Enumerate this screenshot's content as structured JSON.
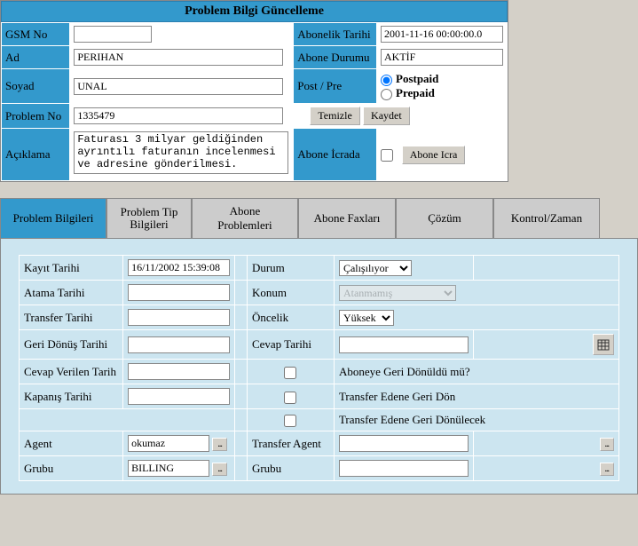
{
  "header": {
    "title": "Problem Bilgi Güncelleme"
  },
  "top": {
    "gsm_no": {
      "label": "GSM No",
      "value": ""
    },
    "abonelik_tarihi": {
      "label": "Abonelik Tarihi",
      "value": "2001-11-16 00:00:00.0"
    },
    "ad": {
      "label": "Ad",
      "value": "PERIHAN"
    },
    "abone_durumu": {
      "label": "Abone Durumu",
      "value": "AKTİF"
    },
    "soyad": {
      "label": "Soyad",
      "value": "UNAL"
    },
    "post_pre": {
      "label": "Post / Pre",
      "postpaid": "Postpaid",
      "prepaid": "Prepaid"
    },
    "problem_no": {
      "label": "Problem No",
      "value": "1335479"
    },
    "temizle": "Temizle",
    "kaydet": "Kaydet",
    "aciklama": {
      "label": "Açıklama",
      "value": "Faturası 3 milyar geldiğinden ayrıntılı faturanın incelenmesi ve adresine gönderilmesi."
    },
    "abone_icrada": {
      "label": "Abone İcrada",
      "button": "Abone Icra"
    }
  },
  "tabs": {
    "t1": "Problem Bilgileri",
    "t2": "Problem Tip Bilgileri",
    "t3": "Abone Problemleri",
    "t4": "Abone Faxları",
    "t5": "Çözüm",
    "t6": "Kontrol/Zaman"
  },
  "detail": {
    "kayit_tarihi": {
      "label": "Kayıt Tarihi",
      "value": "16/11/2002 15:39:08"
    },
    "durum": {
      "label": "Durum",
      "value": "Çalışılıyor"
    },
    "atama_tarihi": {
      "label": "Atama Tarihi",
      "value": ""
    },
    "konum": {
      "label": "Konum",
      "value": "Atanmamış"
    },
    "transfer_tarihi": {
      "label": "Transfer Tarihi",
      "value": ""
    },
    "oncelik": {
      "label": "Öncelik",
      "value": "Yüksek"
    },
    "geri_donus_tarihi": {
      "label": "Geri Dönüş Tarihi",
      "value": ""
    },
    "cevap_tarihi": {
      "label": "Cevap Tarihi",
      "value": ""
    },
    "cevap_verilen_tarih": {
      "label": "Cevap Verilen Tarih",
      "value": ""
    },
    "kapanis_tarihi": {
      "label": "Kapanış Tarihi",
      "value": ""
    },
    "cb1": "Aboneye Geri Dönüldü mü?",
    "cb2": "Transfer Edene Geri Dön",
    "cb3": "Transfer Edene Geri Dönülecek",
    "agent": {
      "label": "Agent",
      "value": "okumaz"
    },
    "transfer_agent": {
      "label": "Transfer Agent",
      "value": ""
    },
    "grubu": {
      "label": "Grubu",
      "value": "BILLING"
    },
    "grubu2": {
      "label": "Grubu",
      "value": ""
    },
    "ellipsis": "..."
  }
}
